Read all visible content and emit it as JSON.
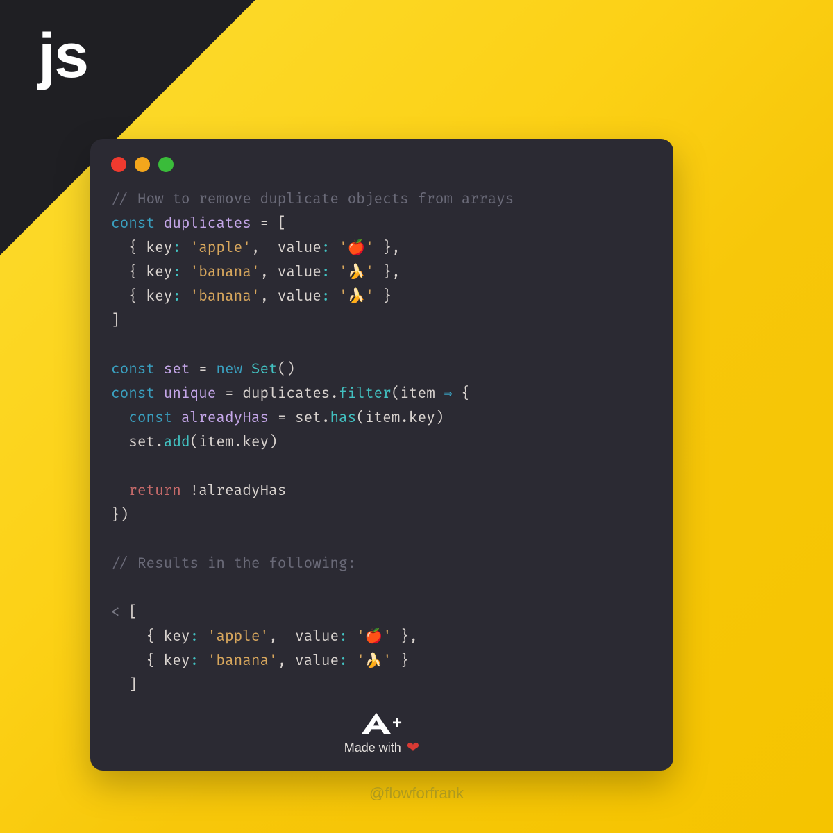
{
  "corner_label": "js",
  "code": {
    "comment_top": "// How to remove duplicate objects from arrays",
    "kw_const": "const",
    "var_duplicates": "duplicates",
    "eq": " = ",
    "bracket_open": "[",
    "obj": {
      "brace_open": "{ ",
      "key_prop": "key",
      "colon": ": ",
      "q_open": "'",
      "q_close": "'",
      "apple": "apple",
      "banana": "banana",
      "comma_sp": ",  ",
      "comma_sp1": ", ",
      "value_prop": "value",
      "emoji_apple": "🍎",
      "emoji_banana": "🍌",
      "brace_close": " }",
      "trailing_comma": ","
    },
    "bracket_close": "]",
    "var_set": "set",
    "kw_new": "new",
    "cls_set": "Set",
    "paren_pair": "()",
    "var_unique": "unique",
    "dot": ".",
    "m_filter": "filter",
    "paren_open": "(",
    "arg_item": "item",
    "arrow": " ⇒ ",
    "brace_open_blk": "{",
    "var_alreadyHas": "alreadyHas",
    "m_has": "has",
    "prop_key": "key",
    "m_add": "add",
    "kw_return": "return",
    "bang": "!",
    "brace_close_blk": "}",
    "paren_close": ")",
    "comment_result": "// Results in the following:",
    "output_caret": "< "
  },
  "footer": {
    "a_plus": "A+",
    "made_with": "Made with",
    "heart": "❤"
  },
  "handle": "@flowforfrank"
}
